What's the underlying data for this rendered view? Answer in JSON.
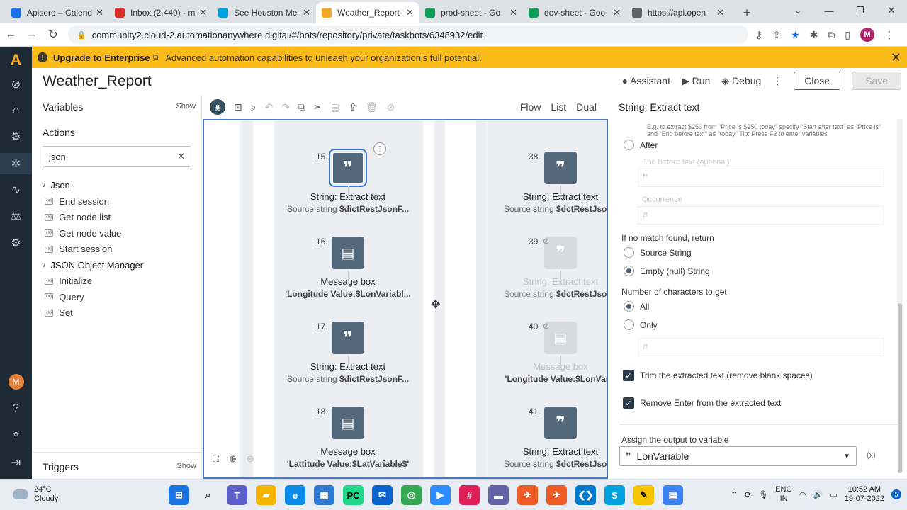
{
  "browser": {
    "tabs": [
      {
        "label": "Apisero – Calend",
        "icon": "calendar-icon",
        "color": "#1a73e8"
      },
      {
        "label": "Inbox (2,449) - m",
        "icon": "gmail-icon",
        "color": "#d93025"
      },
      {
        "label": "See Houston Me",
        "icon": "mulesoft-icon",
        "color": "#00a1df"
      },
      {
        "label": "Weather_Report",
        "icon": "automation-anywhere-icon",
        "color": "#f5a623"
      },
      {
        "label": "prod-sheet - Go",
        "icon": "sheets-icon",
        "color": "#0f9d58"
      },
      {
        "label": "dev-sheet - Goo",
        "icon": "sheets-icon",
        "color": "#0f9d58"
      },
      {
        "label": "https://api.open",
        "icon": "globe-icon",
        "color": "#5f6368"
      }
    ],
    "new_tab": "+",
    "url": "community2.cloud-2.automationanywhere.digital/#/bots/repository/private/taskbots/6348932/edit",
    "profile_initial": "M"
  },
  "banner": {
    "link": "Upgrade to Enterprise",
    "message": "Advanced automation capabilities to unleash your organization’s full potential."
  },
  "header": {
    "title": "Weather_Report",
    "assistant": "Assistant",
    "run": "Run",
    "debug": "Debug",
    "more": "⋮",
    "close": "Close",
    "save": "Save"
  },
  "left": {
    "variables": "Variables",
    "show": "Show",
    "actions": "Actions",
    "search_value": "json",
    "groups": [
      {
        "label": "Json",
        "items": [
          "End session",
          "Get node list",
          "Get node value",
          "Start session"
        ]
      },
      {
        "label": "JSON Object Manager",
        "items": [
          "Initialize",
          "Query",
          "Set"
        ]
      }
    ],
    "triggers": "Triggers",
    "triggers_show": "Show"
  },
  "canvas": {
    "views": [
      "Flow",
      "List",
      "Dual"
    ],
    "left_nodes": [
      {
        "num": "15.",
        "type": "quote",
        "label": "String: Extract text",
        "sub_prefix": "Source string",
        "sub_var": "$dictRestJsonF..."
      },
      {
        "num": "16.",
        "type": "msg",
        "label": "Message box",
        "sub_prefix": "",
        "sub_var": "'Longitude Value:$LonVariabl..."
      },
      {
        "num": "17.",
        "type": "quote",
        "label": "String: Extract text",
        "sub_prefix": "Source string",
        "sub_var": "$dictRestJsonF..."
      },
      {
        "num": "18.",
        "type": "msg",
        "label": "Message box",
        "sub_prefix": "",
        "sub_var": "'Lattitude Value:$LatVariable$'"
      }
    ],
    "right_nodes": [
      {
        "num": "38.",
        "type": "quote",
        "label": "String: Extract text",
        "sub_prefix": "Source string",
        "sub_var": "$dctRestJsonF"
      },
      {
        "num": "39.",
        "type": "quote",
        "label": "String: Extract text",
        "sub_prefix": "Source string",
        "sub_var": "$dctRestJsonF"
      },
      {
        "num": "40.",
        "type": "msg",
        "label": "Message box",
        "sub_prefix": "",
        "sub_var": "'Longitude Value:$LonVaria"
      },
      {
        "num": "41.",
        "type": "quote",
        "label": "String: Extract text",
        "sub_prefix": "Source string",
        "sub_var": "$dctRestJsonF"
      }
    ]
  },
  "props": {
    "title": "String: Extract text",
    "hint": "E.g. to extract $250 from \"Price is $250 today\" specify \"Start after text\" as \"Price is\" and \"End before text\" as \"today\" Tip: Press F2 to enter variables",
    "after": "After",
    "end_before": "End before text (optional)",
    "occurrence": "Occurrence",
    "no_match_label": "If no match found, return",
    "source_string": "Source String",
    "empty_string": "Empty (null) String",
    "num_chars_label": "Number of characters to get",
    "all": "All",
    "only": "Only",
    "trim": "Trim the extracted text (remove blank spaces)",
    "remove_enter": "Remove Enter from the extracted text",
    "assign_label": "Assign the output to variable",
    "assign_value": "LonVariable"
  },
  "taskbar": {
    "temp": "24°C",
    "condition": "Cloudy",
    "lang1": "ENG",
    "lang2": "IN",
    "time": "10:52 AM",
    "date": "19-07-2022",
    "notifications": "5"
  }
}
